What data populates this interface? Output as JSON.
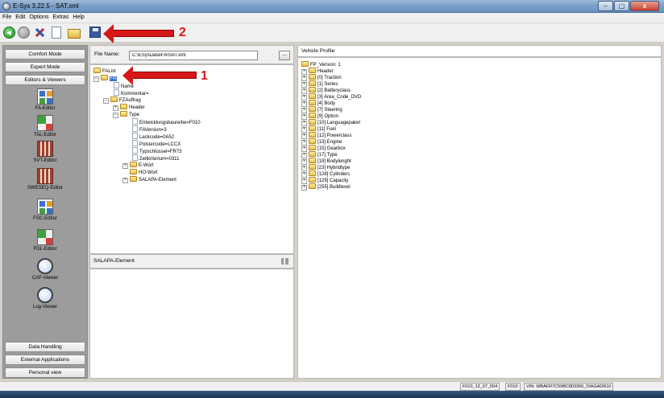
{
  "window": {
    "title": "E-Sys 3.22.5 - SAT.xml",
    "buttons": {
      "minimize": "–",
      "maximize": "▢",
      "close": "x"
    }
  },
  "menu": [
    "File",
    "Edit",
    "Options",
    "Extras",
    "Help"
  ],
  "annotations": {
    "arrow1_label": "1",
    "arrow2_label": "2"
  },
  "sidebar": {
    "top_buttons": [
      "Comfort Mode",
      "Expert Mode",
      "Editors & Viewers"
    ],
    "tools": [
      "FA-Editor",
      "TAL-Editor",
      "SVT-Editor",
      "SWESEQ-Editor",
      "FSC-Editor",
      "FDL-Editor",
      "CAF-Viewer",
      "Log-Viewer"
    ],
    "bottom_buttons": [
      "Data Handling",
      "External Applications",
      "Personal view"
    ]
  },
  "file": {
    "label": "File Name:",
    "value": "C:\\ESysData\\FA\\SAT.xml",
    "browse": "..."
  },
  "fa_tree": {
    "root": "FAList",
    "fa": "FA",
    "name": "Name",
    "kommentar": "Kommentar=",
    "fzauftrag": "FZAuftrag",
    "header": "Header",
    "type": "Type",
    "entwicklung": "Entwicklungsbaureihe=F010",
    "faversion": "FAVersion=3",
    "lackcode": "Lackcode=0A52",
    "polstercode": "Polstercode=LCCX",
    "typschluessel": "Typschlüssel=FR73",
    "zeitkriterium": "Zeitkriterium=0311",
    "ewort": "E-Wort",
    "howort": "HO-Wort",
    "salapa": "SALAPA-Element"
  },
  "salapa_panel": {
    "title": "SALAPA-Element"
  },
  "vehicle_profile": {
    "title": "Vehicle Profile",
    "root": "FP_Version: 1",
    "items": [
      "Header",
      "[0] Traction",
      "[1] Series",
      "[2] Batteryclass",
      "[3] Area_Code_DVD",
      "[4] Body",
      "[7] Steering",
      "[9] Option",
      "[10] Languagepaket",
      "[11] Fuel",
      "[12] Powerclass",
      "[13] Engine",
      "[15] Gearbox",
      "[17] Type",
      "[19] Bodylenght",
      "[23] Hybridtype",
      "[128] Cylinders",
      "[129] Capacity",
      "[255] Buildlevel"
    ]
  },
  "status": {
    "cell1": "F010_13_07_504",
    "cell2": "F010",
    "cell3": "VIN: WBAFR7C59BC803369_DIAGADR10"
  }
}
